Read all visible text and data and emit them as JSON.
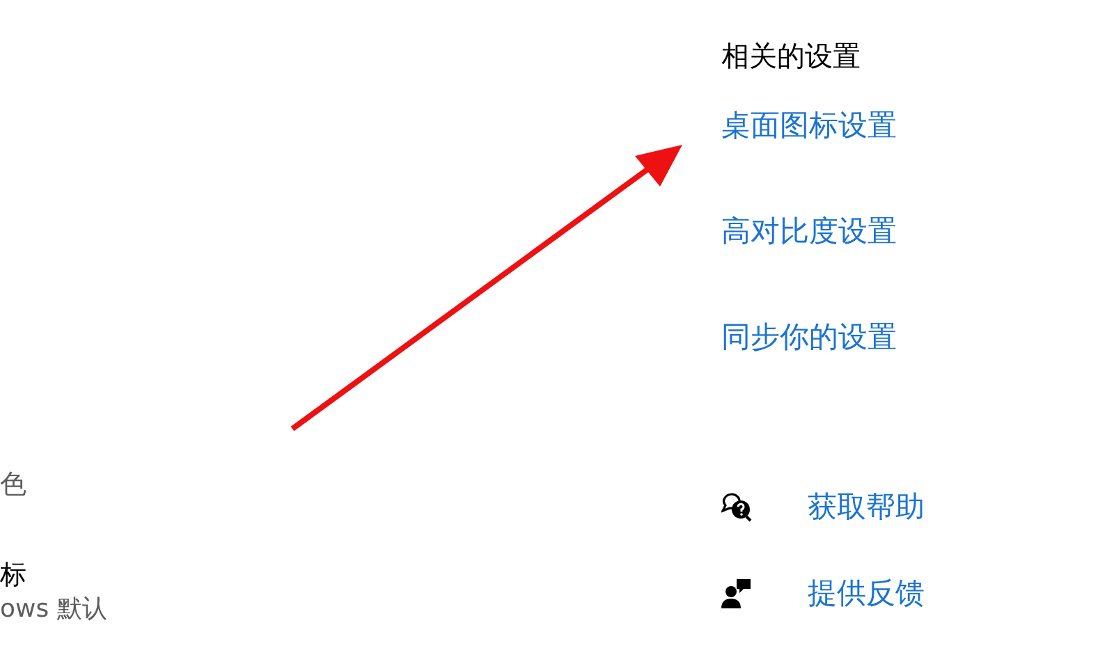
{
  "left_texts": [
    {
      "text": "色",
      "kind": "secondary"
    },
    {
      "text": "标",
      "kind": "primary"
    },
    {
      "text": "ows 默认",
      "kind": "secondary"
    }
  ],
  "related_settings": {
    "title": "相关的设置",
    "links": [
      "桌面图标设置",
      "高对比度设置",
      "同步你的设置"
    ]
  },
  "help_links": [
    {
      "label": "获取帮助",
      "kind": "help"
    },
    {
      "label": "提供反馈",
      "kind": "feedback"
    }
  ]
}
